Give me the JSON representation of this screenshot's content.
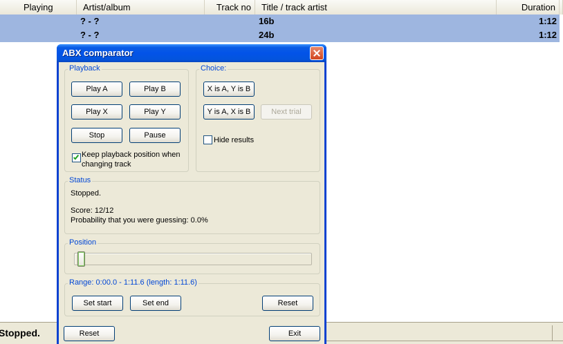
{
  "playlist": {
    "columns": {
      "playing": "Playing",
      "artist": "Artist/album",
      "track_no": "Track no",
      "title": "Title / track artist",
      "duration": "Duration"
    },
    "rows": [
      {
        "artist": "? - ?",
        "title": "16b",
        "duration": "1:12",
        "selected": true
      },
      {
        "artist": "? - ?",
        "title": "24b",
        "duration": "1:12",
        "selected": true
      }
    ]
  },
  "statusbar": {
    "text": "Stopped."
  },
  "dialog": {
    "title": "ABX comparator",
    "playback": {
      "legend": "Playback",
      "play_a": "Play A",
      "play_b": "Play B",
      "play_x": "Play X",
      "play_y": "Play Y",
      "stop": "Stop",
      "pause": "Pause",
      "keep_position_line1": "Keep playback position when",
      "keep_position_line2": "changing track",
      "keep_position_checked": true
    },
    "choice": {
      "legend": "Choice:",
      "x_is_a": "X is A, Y is B",
      "y_is_a": "Y is A, X is B",
      "next_trial": "Next trial",
      "next_trial_enabled": false,
      "hide_results": "Hide results",
      "hide_results_checked": false
    },
    "status": {
      "legend": "Status",
      "state": "Stopped.",
      "score": "Score: 12/12",
      "probability": "Probability that you were guessing: 0.0%"
    },
    "position": {
      "legend": "Position",
      "value_fraction": 0.0
    },
    "range": {
      "legend": "Range: 0:00.0 - 1:11.6 (length: 1:11.6)",
      "set_start": "Set start",
      "set_end": "Set end",
      "reset": "Reset"
    },
    "footer": {
      "reset": "Reset",
      "exit": "Exit"
    }
  },
  "colors": {
    "selection": "#9eb6e0",
    "titlebar": "#0353e8",
    "legend_text": "#0046d5",
    "dialog_bg": "#ece9d8"
  }
}
